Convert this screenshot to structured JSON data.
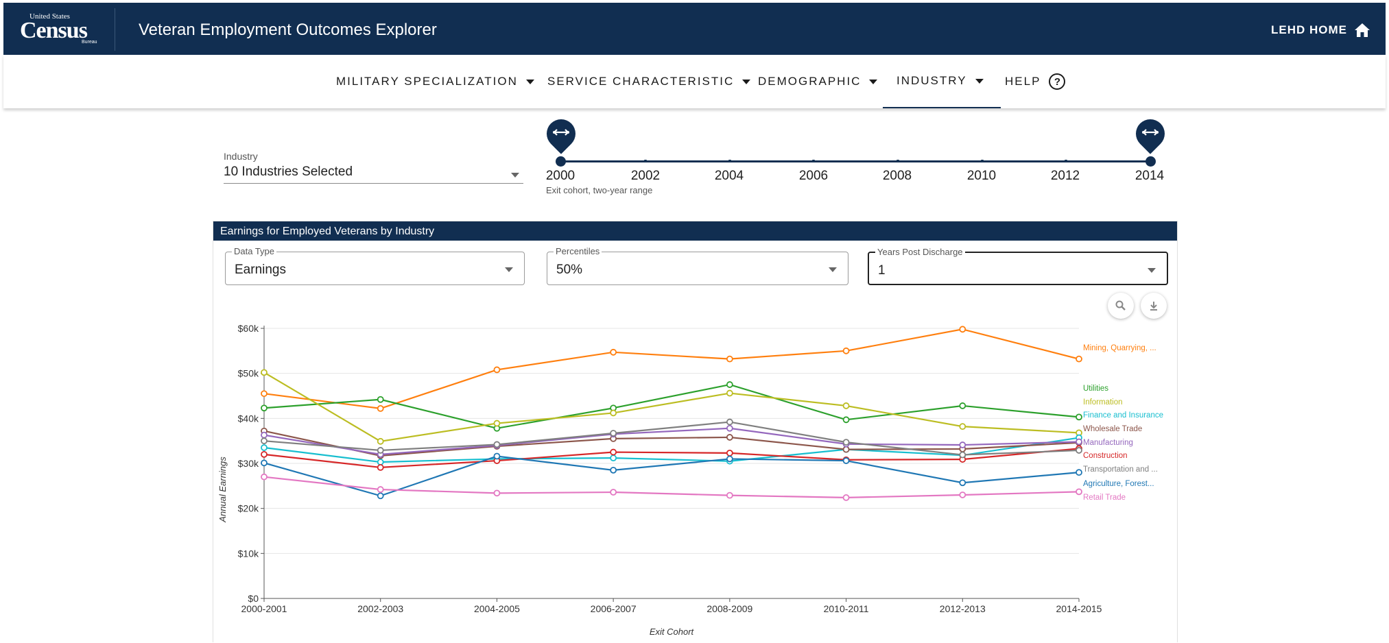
{
  "header": {
    "logo_us": "United States",
    "logo_census": "Census",
    "logo_bureau": "Bureau",
    "title": "Veteran Employment Outcomes Explorer",
    "home_link": "LEHD HOME",
    "home_icon": "home-icon"
  },
  "nav": {
    "items": [
      {
        "label": "MILITARY SPECIALIZATION"
      },
      {
        "label": "SERVICE CHARACTERISTIC"
      },
      {
        "label": "DEMOGRAPHIC"
      },
      {
        "label": "INDUSTRY"
      },
      {
        "label": "HELP"
      }
    ],
    "active": "INDUSTRY"
  },
  "industry_select": {
    "label": "Industry",
    "value": "10 Industries Selected"
  },
  "cohort_slider": {
    "years": [
      "2000",
      "2002",
      "2004",
      "2006",
      "2008",
      "2010",
      "2012",
      "2014"
    ],
    "selected_start": "2000",
    "selected_end": "2014",
    "caption": "Exit cohort, two-year range"
  },
  "card": {
    "title": "Earnings for Employed Veterans by Industry",
    "data_type": {
      "legend": "Data Type",
      "value": "Earnings"
    },
    "percentiles": {
      "legend": "Percentiles",
      "value": "50%"
    },
    "years_post": {
      "legend": "Years Post Discharge",
      "value": "1"
    },
    "zoom_icon": "magnify-icon",
    "download_icon": "download-icon"
  },
  "chart_data": {
    "type": "line",
    "xlabel": "Exit Cohort",
    "ylabel": "Annual Earnings",
    "ylim": [
      0,
      60000
    ],
    "y_ticks": [
      {
        "value": 0,
        "label": "$0"
      },
      {
        "value": 10000,
        "label": "$10k"
      },
      {
        "value": 20000,
        "label": "$20k"
      },
      {
        "value": 30000,
        "label": "$30k"
      },
      {
        "value": 40000,
        "label": "$40k"
      },
      {
        "value": 50000,
        "label": "$50k"
      },
      {
        "value": 60000,
        "label": "$60k"
      }
    ],
    "grid": true,
    "legend": "right (end-of-line labels)",
    "categories": [
      "2000-2001",
      "2002-2003",
      "2004-2005",
      "2006-2007",
      "2008-2009",
      "2010-2011",
      "2012-2013",
      "2014-2015"
    ],
    "series": [
      {
        "name": "Mining, Quarrying, ...",
        "color": "#ff7f0e",
        "values": [
          45500,
          42200,
          50800,
          54700,
          53200,
          55000,
          59800,
          53200
        ]
      },
      {
        "name": "Utilities",
        "color": "#2ca02c",
        "values": [
          42300,
          44200,
          37800,
          42300,
          47500,
          39700,
          42800,
          40300
        ]
      },
      {
        "name": "Information",
        "color": "#bcbd22",
        "values": [
          50200,
          34900,
          38900,
          41200,
          45600,
          42800,
          38200,
          36800
        ]
      },
      {
        "name": "Finance and Insurance",
        "color": "#17becf",
        "values": [
          33500,
          30300,
          31000,
          31200,
          30500,
          33100,
          31800,
          35700
        ]
      },
      {
        "name": "Wholesale Trade",
        "color": "#8c564b",
        "values": [
          37200,
          31700,
          33800,
          35500,
          35800,
          33100,
          33200,
          34600
        ]
      },
      {
        "name": "Manufacturing",
        "color": "#9467bd",
        "values": [
          36300,
          32000,
          34000,
          36500,
          37800,
          34300,
          34100,
          34800
        ]
      },
      {
        "name": "Construction",
        "color": "#d62728",
        "values": [
          32000,
          29100,
          30600,
          32500,
          32300,
          30800,
          30900,
          33300
        ]
      },
      {
        "name": "Transportation and ...",
        "color": "#7f7f7f",
        "values": [
          35000,
          32900,
          34200,
          36700,
          39200,
          34700,
          31900,
          32900
        ]
      },
      {
        "name": "Agriculture, Forest...",
        "color": "#1f77b4",
        "values": [
          30100,
          22800,
          31600,
          28500,
          31000,
          30600,
          25700,
          28000
        ]
      },
      {
        "name": "Retail Trade",
        "color": "#e377c2",
        "values": [
          27000,
          24200,
          23400,
          23600,
          22900,
          22400,
          23000,
          23700
        ]
      }
    ]
  }
}
